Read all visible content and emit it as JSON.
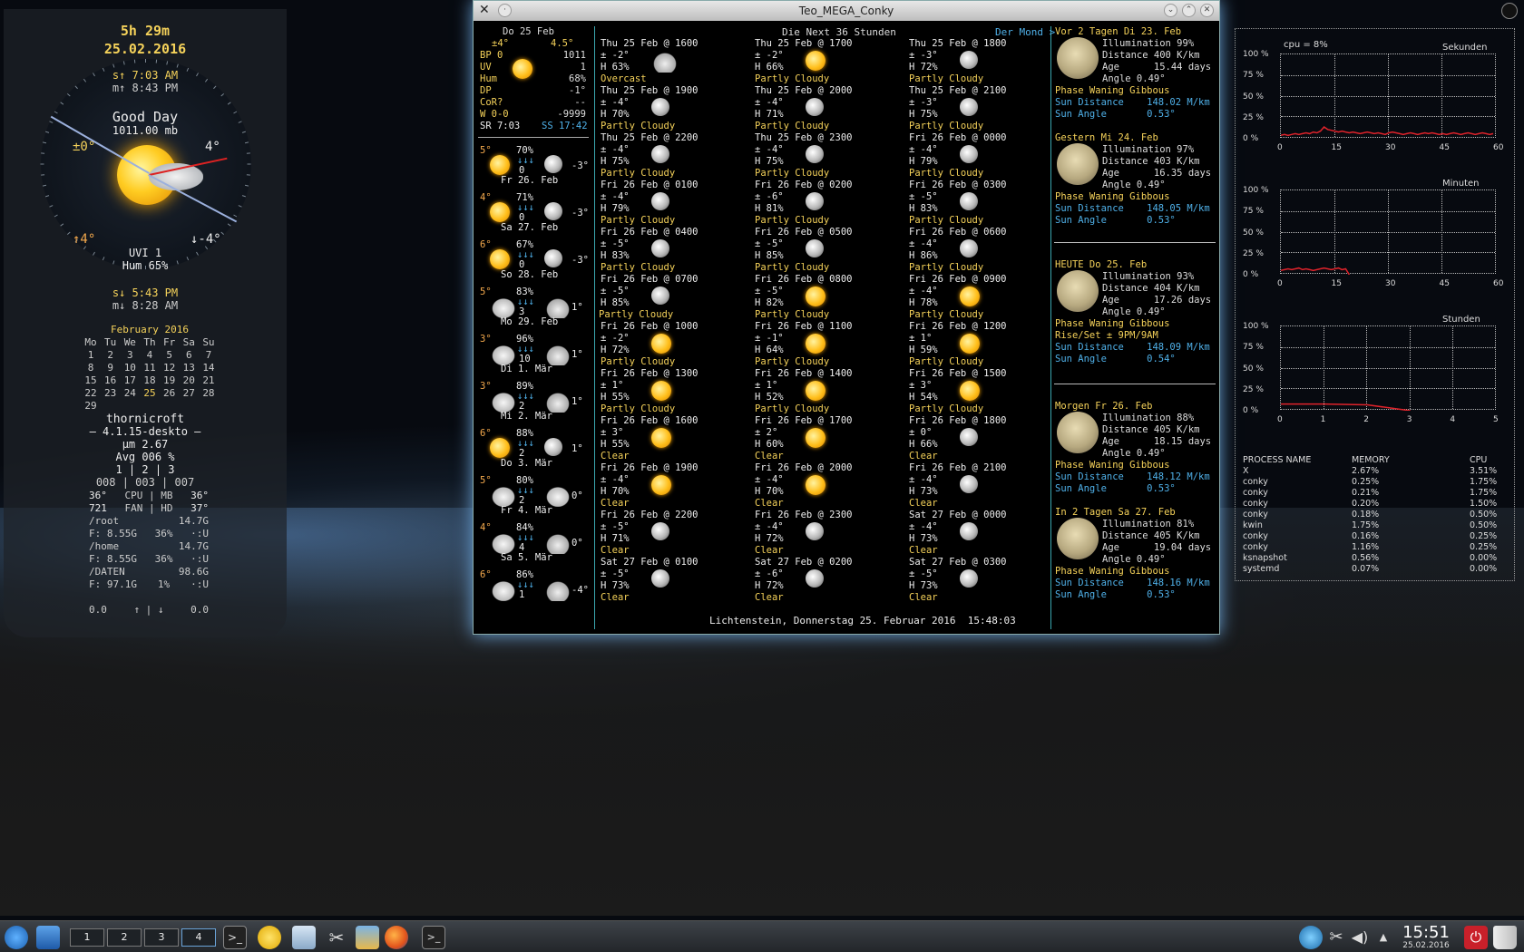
{
  "left": {
    "time_left": "5h 29m",
    "date": "25.02.2016",
    "sunrise": "s↑ 7:03 AM",
    "moonset": "m↑ 8:43 PM",
    "greeting": "Good Day",
    "pressure": "1011.00 mb",
    "temp_now": "±0°",
    "temp_feel": "4°",
    "temp_high": "↑4°",
    "temp_low": "↓-4°",
    "uvi": "UVI 1",
    "hum": "Hum 65%",
    "sunset": "s↓ 5:43 PM",
    "moonrise": "m↓ 8:28 AM",
    "calendar": {
      "title": "February 2016",
      "days": [
        "Mo",
        "Tu",
        "We",
        "Th",
        "Fr",
        "Sa",
        "Su"
      ],
      "rows": [
        [
          "1",
          "2",
          "3",
          "4",
          "5",
          "6",
          "7"
        ],
        [
          "8",
          "9",
          "10",
          "11",
          "12",
          "13",
          "14"
        ],
        [
          "15",
          "16",
          "17",
          "18",
          "19",
          "20",
          "21"
        ],
        [
          "22",
          "23",
          "24",
          "25",
          "26",
          "27",
          "28"
        ],
        [
          "29",
          "",
          "",
          "",
          "",
          "",
          ""
        ]
      ]
    },
    "host": "thornicroft",
    "kernel": "— 4.1.15-deskto —",
    "load": "µm 2.67",
    "avg": "Avg 006 %",
    "cores": "1  |  2  |  3",
    "core_vals": "008 | 003 | 007",
    "sys": [
      [
        "36°",
        "CPU | MB",
        "36°"
      ],
      [
        "721",
        "FAN | HD",
        "37°"
      ],
      [
        "/root",
        "",
        "14.7G"
      ],
      [
        "F: 8.55G",
        "36%",
        "·:U"
      ],
      [
        "/home",
        "",
        "14.7G"
      ],
      [
        "F: 8.55G",
        "36%",
        "·:U"
      ],
      [
        "/DATEN",
        "",
        "98.6G"
      ],
      [
        "F: 97.1G",
        "1%",
        "·:U"
      ]
    ],
    "net": [
      "0.0",
      "↑ | ↓",
      "0.0"
    ]
  },
  "window": {
    "title": "Teo_MEGA_Conky",
    "today": {
      "head": "Do 25 Feb",
      "t1": "±4°",
      "t2": "4.5°",
      "rows": [
        [
          "BP 0",
          "1011"
        ],
        [
          "UV",
          "1"
        ],
        [
          "Hum",
          "68%"
        ],
        [
          "DP",
          "-1°"
        ],
        [
          "CoR?",
          "--"
        ],
        [
          "W 0-0",
          "-9999"
        ]
      ],
      "sr": "SR 7:03",
      "ss": "SS 17:42"
    },
    "days": [
      {
        "hi": "5°",
        "hum": "70%",
        "p": "0",
        "lo": "-3°",
        "name": "Fr 26. Feb",
        "i1": "isun",
        "i2": "imoon"
      },
      {
        "hi": "4°",
        "hum": "71%",
        "p": "0",
        "lo": "-3°",
        "name": "Sa 27. Feb",
        "i1": "isun",
        "i2": "imoon"
      },
      {
        "hi": "6°",
        "hum": "67%",
        "p": "0",
        "lo": "-3°",
        "name": "So 28. Feb",
        "i1": "isun",
        "i2": "imoon"
      },
      {
        "hi": "5°",
        "hum": "83%",
        "p": "3",
        "lo": "1°",
        "name": "Mo 29. Feb",
        "i1": "isnow",
        "i2": "icloud"
      },
      {
        "hi": "3°",
        "hum": "96%",
        "p": "10",
        "lo": "1°",
        "name": "Di 1. Mär",
        "i1": "isnow",
        "i2": "icloud"
      },
      {
        "hi": "3°",
        "hum": "89%",
        "p": "2",
        "lo": "1°",
        "name": "Mi 2. Mär",
        "i1": "isnow",
        "i2": "icloud"
      },
      {
        "hi": "6°",
        "hum": "88%",
        "p": "2",
        "lo": "1°",
        "name": "Do 3. Mär",
        "i1": "isun",
        "i2": "imoon"
      },
      {
        "hi": "5°",
        "hum": "80%",
        "p": "2",
        "lo": "0°",
        "name": "Fr 4. Mär",
        "i1": "isnow",
        "i2": "isnow"
      },
      {
        "hi": "4°",
        "hum": "84%",
        "p": "4",
        "lo": "0°",
        "name": "Sa 5. Mär",
        "i1": "isnow",
        "i2": "icloud"
      },
      {
        "hi": "6°",
        "hum": "86%",
        "p": "1",
        "lo": "-4°",
        "name": "",
        "i1": "isnow",
        "i2": "icloud"
      }
    ],
    "next_title": "Die Next 36 Stunden",
    "mond_link": "Der Mond >",
    "hours": [
      [
        "Thu 25 Feb @ 1600",
        "± -2°",
        "H 63%",
        "Overcast",
        "icloud"
      ],
      [
        "Thu 25 Feb @ 1700",
        "± -2°",
        "H 66%",
        "Partly Cloudy",
        "isun"
      ],
      [
        "Thu 25 Feb @ 1800",
        "± -3°",
        "H 72%",
        "Partly Cloudy",
        "imoon"
      ],
      [
        "Thu 25 Feb @ 1900",
        "± -4°",
        "H 70%",
        "Partly Cloudy",
        "imoon"
      ],
      [
        "Thu 25 Feb @ 2000",
        "± -4°",
        "H 71%",
        "Partly Cloudy",
        "imoon"
      ],
      [
        "Thu 25 Feb @ 2100",
        "± -3°",
        "H 75%",
        "Partly Cloudy",
        "imoon"
      ],
      [
        "Thu 25 Feb @ 2200",
        "± -4°",
        "H 75%",
        "Partly Cloudy",
        "imoon"
      ],
      [
        "Thu 25 Feb @ 2300",
        "± -4°",
        "H 75%",
        "Partly Cloudy",
        "imoon"
      ],
      [
        "Fri 26 Feb @ 0000",
        "± -4°",
        "H 79%",
        "Partly Cloudy",
        "imoon"
      ],
      [
        "Fri 26 Feb @ 0100",
        "± -4°",
        "H 79%",
        "Partly Cloudy",
        "imoon"
      ],
      [
        "Fri 26 Feb @ 0200",
        "± -6°",
        "H 81%",
        "Partly Cloudy",
        "imoon"
      ],
      [
        "Fri 26 Feb @ 0300",
        "± -5°",
        "H 83%",
        "Partly Cloudy",
        "imoon"
      ],
      [
        "Fri 26 Feb @ 0400",
        "± -5°",
        "H 83%",
        "Partly Cloudy",
        "imoon"
      ],
      [
        "Fri 26 Feb @ 0500",
        "± -5°",
        "H 85%",
        "Partly Cloudy",
        "imoon"
      ],
      [
        "Fri 26 Feb @ 0600",
        "± -4°",
        "H 86%",
        "Partly Cloudy",
        "imoon"
      ],
      [
        "Fri 26 Feb @ 0700",
        "± -5°",
        "H 85%",
        "Partly Cloudy",
        "imoon"
      ],
      [
        "Fri 26 Feb @ 0800",
        "± -5°",
        "H 82%",
        "Partly Cloudy",
        "isun"
      ],
      [
        "Fri 26 Feb @ 0900",
        "± -4°",
        "H 78%",
        "Partly Cloudy",
        "isun"
      ],
      [
        "Fri 26 Feb @ 1000",
        "± -2°",
        "H 72%",
        "Partly Cloudy",
        "isun"
      ],
      [
        "Fri 26 Feb @ 1100",
        "± -1°",
        "H 64%",
        "Partly Cloudy",
        "isun"
      ],
      [
        "Fri 26 Feb @ 1200",
        "± 1°",
        "H 59%",
        "Partly Cloudy",
        "isun"
      ],
      [
        "Fri 26 Feb @ 1300",
        "± 1°",
        "H 55%",
        "Partly Cloudy",
        "isun"
      ],
      [
        "Fri 26 Feb @ 1400",
        "± 1°",
        "H 52%",
        "Partly Cloudy",
        "isun"
      ],
      [
        "Fri 26 Feb @ 1500",
        "± 3°",
        "H 54%",
        "Partly Cloudy",
        "isun"
      ],
      [
        "Fri 26 Feb @ 1600",
        "± 3°",
        "H 55%",
        "Clear",
        "isun"
      ],
      [
        "Fri 26 Feb @ 1700",
        "± 2°",
        "H 60%",
        "Clear",
        "isun"
      ],
      [
        "Fri 26 Feb @ 1800",
        "± 0°",
        "H 66%",
        "Clear",
        "imoon"
      ],
      [
        "Fri 26 Feb @ 1900",
        "± -4°",
        "H 70%",
        "Clear",
        "isun"
      ],
      [
        "Fri 26 Feb @ 2000",
        "± -4°",
        "H 70%",
        "Clear",
        "isun"
      ],
      [
        "Fri 26 Feb @ 2100",
        "± -4°",
        "H 73%",
        "Clear",
        "imoon"
      ],
      [
        "Fri 26 Feb @ 2200",
        "± -5°",
        "H 71%",
        "Clear",
        "imoon"
      ],
      [
        "Fri 26 Feb @ 2300",
        "± -4°",
        "H 72%",
        "Clear",
        "imoon"
      ],
      [
        "Sat 27 Feb @ 0000",
        "± -4°",
        "H 73%",
        "Clear",
        "imoon"
      ],
      [
        "Sat 27 Feb @ 0100",
        "± -5°",
        "H 73%",
        "Clear",
        "imoon"
      ],
      [
        "Sat 27 Feb @ 0200",
        "± -6°",
        "H 72%",
        "Clear",
        "imoon"
      ],
      [
        "Sat 27 Feb @ 0300",
        "± -5°",
        "H 73%",
        "Clear",
        "imoon"
      ]
    ],
    "footer": "Lichtenstein, Donnerstag 25. Februar 2016  15:48:03",
    "moon": [
      {
        "head": "Vor 2 Tagen Di 23. Feb",
        "ill": "Illumination 99%",
        "dist": "Distance 400 K/km",
        "age": "Age      15.44 days",
        "angle": "Angle 0.49°",
        "phase": "Phase Waning Gibbous",
        "extra": "",
        "sund": "Sun Distance    148.02 M/km",
        "suna": "Sun Angle       0.53°"
      },
      {
        "head": "Gestern Mi 24. Feb",
        "ill": "Illumination 97%",
        "dist": "Distance 403 K/km",
        "age": "Age      16.35 days",
        "angle": "Angle 0.49°",
        "phase": "Phase Waning Gibbous",
        "extra": "",
        "sund": "Sun Distance    148.05 M/km",
        "suna": "Sun Angle       0.53°"
      },
      {
        "head": "HEUTE Do 25. Feb",
        "ill": "Illumination 93%",
        "dist": "Distance 404 K/km",
        "age": "Age      17.26 days",
        "angle": "Angle 0.49°",
        "phase": "Phase Waning Gibbous",
        "extra": "Rise/Set ± 9PM/9AM",
        "sund": "Sun Distance    148.09 M/km",
        "suna": "Sun Angle       0.54°"
      },
      {
        "head": "Morgen Fr 26. Feb",
        "ill": "Illumination 88%",
        "dist": "Distance 405 K/km",
        "age": "Age      18.15 days",
        "angle": "Angle 0.49°",
        "phase": "Phase Waning Gibbous",
        "extra": "",
        "sund": "Sun Distance    148.12 M/km",
        "suna": "Sun Angle       0.53°"
      },
      {
        "head": "In 2 Tagen Sa 27. Feb",
        "ill": "Illumination 81%",
        "dist": "Distance 405 K/km",
        "age": "Age      19.04 days",
        "angle": "Angle 0.49°",
        "phase": "Phase Waning Gibbous",
        "extra": "",
        "sund": "Sun Distance    148.16 M/km",
        "suna": "Sun Angle       0.53°"
      }
    ]
  },
  "right": {
    "cpu_label": "cpu = 8%",
    "graphs": [
      {
        "title": "Sekunden",
        "yticks": [
          "100 %",
          "75 %",
          "50 %",
          "25 %",
          "0 %"
        ],
        "xticks": [
          "0",
          "15",
          "30",
          "45",
          "60"
        ],
        "values": [
          4,
          5,
          4,
          5,
          6,
          5,
          6,
          7,
          6,
          8,
          7,
          9,
          14,
          11,
          10,
          9,
          8,
          9,
          8,
          7,
          8,
          7,
          6,
          7,
          8,
          7,
          6,
          7,
          6,
          5,
          7,
          8,
          7,
          6,
          5,
          6,
          7,
          6,
          5,
          6,
          7,
          6,
          7,
          6,
          5,
          6,
          5,
          6,
          7,
          6,
          5,
          6,
          7,
          6,
          5,
          6,
          7,
          6,
          5,
          6
        ]
      },
      {
        "title": "Minuten",
        "yticks": [
          "100 %",
          "75 %",
          "50 %",
          "25 %",
          "0 %"
        ],
        "xticks": [
          "0",
          "15",
          "30",
          "45",
          "60"
        ],
        "values": [
          5,
          6,
          7,
          6,
          7,
          8,
          6,
          7,
          6,
          5,
          6,
          7,
          8,
          7,
          6,
          7,
          8,
          6,
          7,
          0
        ]
      },
      {
        "title": "Stunden",
        "yticks": [
          "100 %",
          "75 %",
          "50 %",
          "25 %",
          "0 %"
        ],
        "xticks": [
          "0",
          "1",
          "2",
          "3",
          "4",
          "5"
        ],
        "values": [
          8,
          8,
          7,
          0
        ]
      }
    ],
    "proc_headers": [
      "PROCESS NAME",
      "MEMORY",
      "CPU"
    ],
    "procs": [
      [
        "X",
        "2.67%",
        "3.51%"
      ],
      [
        "conky",
        "0.25%",
        "1.75%"
      ],
      [
        "conky",
        "0.21%",
        "1.75%"
      ],
      [
        "conky",
        "0.20%",
        "1.50%"
      ],
      [
        "conky",
        "0.18%",
        "0.50%"
      ],
      [
        "kwin",
        "1.75%",
        "0.50%"
      ],
      [
        "conky",
        "0.16%",
        "0.25%"
      ],
      [
        "conky",
        "1.16%",
        "0.25%"
      ],
      [
        "ksnapshot",
        "0.56%",
        "0.00%"
      ],
      [
        "systemd",
        "0.07%",
        "0.00%"
      ]
    ]
  },
  "taskbar": {
    "desktops": [
      "1",
      "2",
      "3",
      "4"
    ],
    "clock": "15:51",
    "date": "25.02.2016"
  }
}
